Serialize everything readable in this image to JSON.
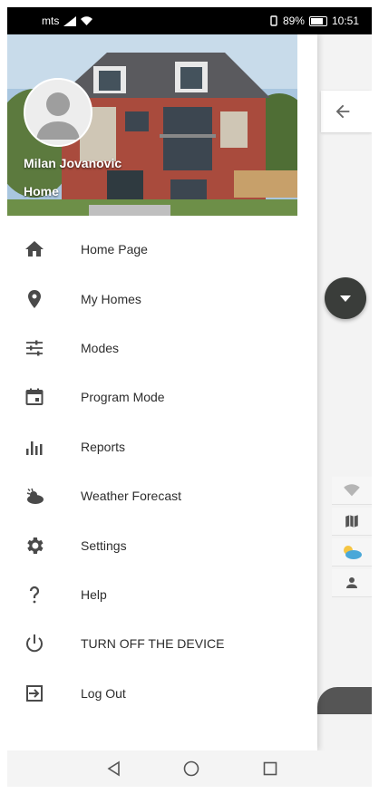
{
  "status_bar": {
    "carrier": "mts",
    "battery_percent": "89%",
    "time": "10:51"
  },
  "header": {
    "user_name": "Milan Jovanovic",
    "subtitle": "Home"
  },
  "menu": {
    "items": [
      {
        "label": "Home Page",
        "icon": "home-icon"
      },
      {
        "label": "My Homes",
        "icon": "location-pin-icon"
      },
      {
        "label": "Modes",
        "icon": "sliders-icon"
      },
      {
        "label": "Program Mode",
        "icon": "calendar-icon"
      },
      {
        "label": "Reports",
        "icon": "bar-chart-icon"
      },
      {
        "label": "Weather Forecast",
        "icon": "weather-icon"
      },
      {
        "label": "Settings",
        "icon": "gear-icon"
      },
      {
        "label": "Help",
        "icon": "help-icon"
      },
      {
        "label": "TURN OFF THE DEVICE",
        "icon": "power-icon"
      },
      {
        "label": "Log Out",
        "icon": "logout-icon"
      }
    ]
  },
  "background_app": {
    "icons": [
      "back-arrow-icon",
      "dropdown-icon",
      "wifi-icon",
      "map-icon",
      "weather-icon",
      "person-icon"
    ]
  },
  "nav_bar": {
    "buttons": [
      "back-triangle-icon",
      "home-circle-icon",
      "recents-square-icon"
    ]
  },
  "colors": {
    "status_bar": "#000000",
    "icon": "#4a4a4a",
    "fab": "#3a3d3a",
    "text": "#2d2d2d"
  }
}
